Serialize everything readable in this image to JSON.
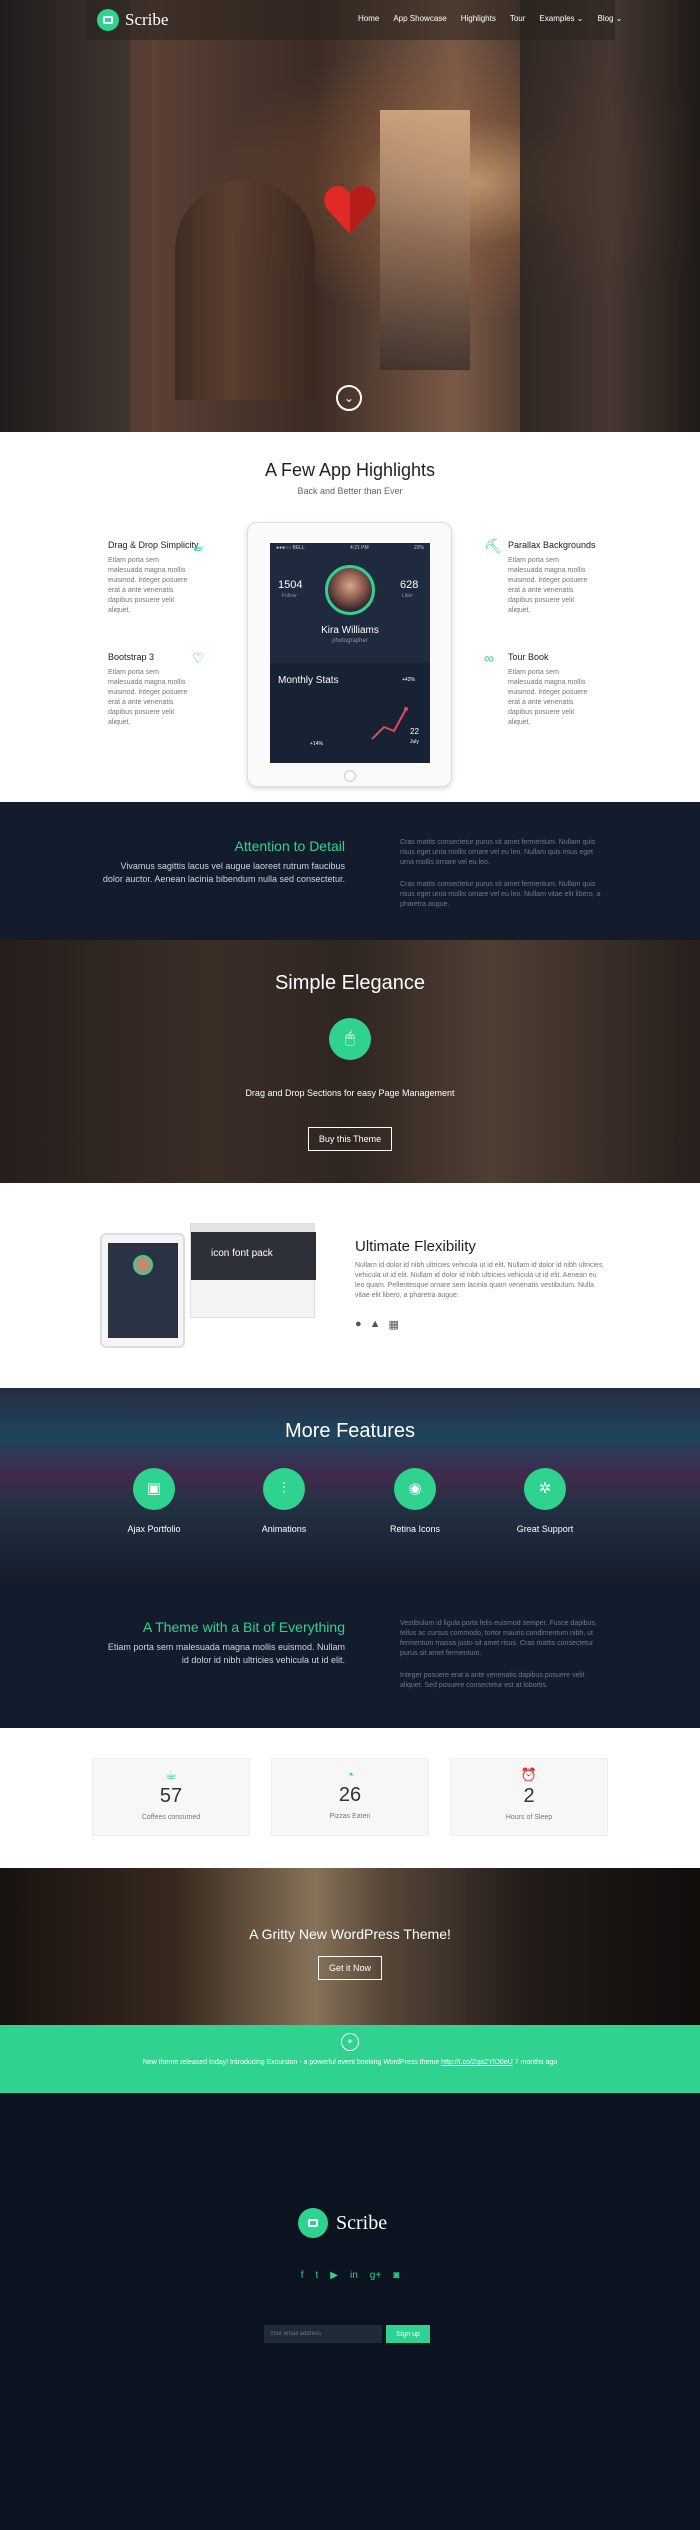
{
  "brand": {
    "name": "Scribe",
    "accent": "#2fd38f",
    "dark": "#121c2d"
  },
  "nav": [
    "Home",
    "App Showcase",
    "Highlights",
    "Tour",
    "Examples ⌄",
    "Blog ⌄"
  ],
  "highlights": {
    "title": "A Few App Highlights",
    "subtitle": "Back and Better than Ever",
    "features": [
      {
        "title": "Drag & Drop Simplicity",
        "text": "Etiam porta sem malesuada magna mollis euismod. Integer posuere erat a ante venenatis dapibus posuere velit aliquet.",
        "icon": "cup-icon"
      },
      {
        "title": "Bootstrap 3",
        "text": "Etiam porta sem malesuada magna mollis euismod. Integer posuere erat a ante venenatis dapibus posuere velit aliquet.",
        "icon": "heart-icon"
      },
      {
        "title": "Parallax Backgrounds",
        "text": "Etiam porta sem malesuada magna mollis euismod. Integer posuere erat a ante venenatis dapibus posuere velit aliquet.",
        "icon": "paint-roller-icon"
      },
      {
        "title": "Tour Book",
        "text": "Etiam porta sem malesuada magna mollis euismod. Integer posuere erat a ante venenatis dapibus posuere velit aliquet.",
        "icon": "glasses-icon"
      }
    ],
    "app": {
      "carrier": "●●●○○ BELL",
      "time": "4:21 PM",
      "battery": "22%",
      "follows": "1504",
      "follows_label": "Follow",
      "likes": "628",
      "likes_label": "Liker",
      "name": "Kira Williams",
      "job": "photographer",
      "stats_title": "Monthly Stats",
      "stat_a": "+42%",
      "stat_b": "+14%",
      "date_num": "22",
      "date_month": "July"
    }
  },
  "attention": {
    "title": "Attention to Detail",
    "lead": "Vivamus sagittis lacus vel augue laoreet rutrum faucibus dolor auctor. Aenean lacinia bibendum nulla sed consectetur.",
    "para1": "Cras mattis consectetur purus sit amet fermentum. Nullam quis risus eget urna mollis ornare vel eu leo. Nullam quis risus eget urna mollis ornare vel eu leo.",
    "para2": "Cras mattis consectetur purus sit amet fermentum. Nullam quis risus eget urna mollis ornare vel eu leo. Nullam vitae elit libero, a pharetra augue."
  },
  "elegance": {
    "title": "Simple Elegance",
    "text": "Drag and Drop Sections for easy Page Management",
    "button": "Buy this Theme"
  },
  "flex": {
    "title": "Ultimate Flexibility",
    "desc": "Nullam id dolor id nibh ultricies vehicula ut id elit. Nullam id dolor id nibh ultricies vehicula ut id elit. Nullam id dolor id nibh ultricies vehicula ut id elit. Aenean eu leo quam. Pellentesque ornare sem lacinia quam venenatis vestibulum. Nulla vitae elit libero, a pharetra augue.",
    "mock_label": "icon font pack"
  },
  "more": {
    "title": "More Features",
    "items": [
      {
        "label": "Ajax Portfolio",
        "icon": "portfolio-icon"
      },
      {
        "label": "Animations",
        "icon": "sliders-icon"
      },
      {
        "label": "Retina Icons",
        "icon": "eye-icon"
      },
      {
        "label": "Great Support",
        "icon": "lifebuoy-icon"
      }
    ]
  },
  "bit": {
    "title": "A Theme with a Bit of Everything",
    "lead": "Etiam porta sem malesuada magna mollis euismod. Nullam id dolor id nibh ultricies vehicula ut id elit.",
    "para1": "Vestibulum id ligula porta felis euismod semper. Fusce dapibus, tellus ac cursus commodo, tortor mauris condimentum nibh, ut fermentum massa justo sit amet risus. Cras mattis consectetur purus sit amet fermentum.",
    "para2": "Integer posuere erat a ante venenatis dapibus posuere velit aliquet. Sed posuere consectetur est at lobortis."
  },
  "counters": [
    {
      "value": "57",
      "label": "Coffees consumed",
      "icon": "coffee-icon"
    },
    {
      "value": "26",
      "label": "Pizzas Eaten",
      "icon": "pizza-icon"
    },
    {
      "value": "2",
      "label": "Hours of Sleep",
      "icon": "alarm-icon"
    }
  ],
  "gritty": {
    "title": "A Gritty New WordPress Theme!",
    "button": "Get it Now"
  },
  "tweet": {
    "text": "New theme released today! Introducing Excursion - a powerful event booking WordPress theme",
    "link": "http://t.co/ZqaZYlO0eU",
    "time": "7 months ago"
  },
  "footer": {
    "email_placeholder": "Your email address",
    "signup": "Sign up"
  }
}
